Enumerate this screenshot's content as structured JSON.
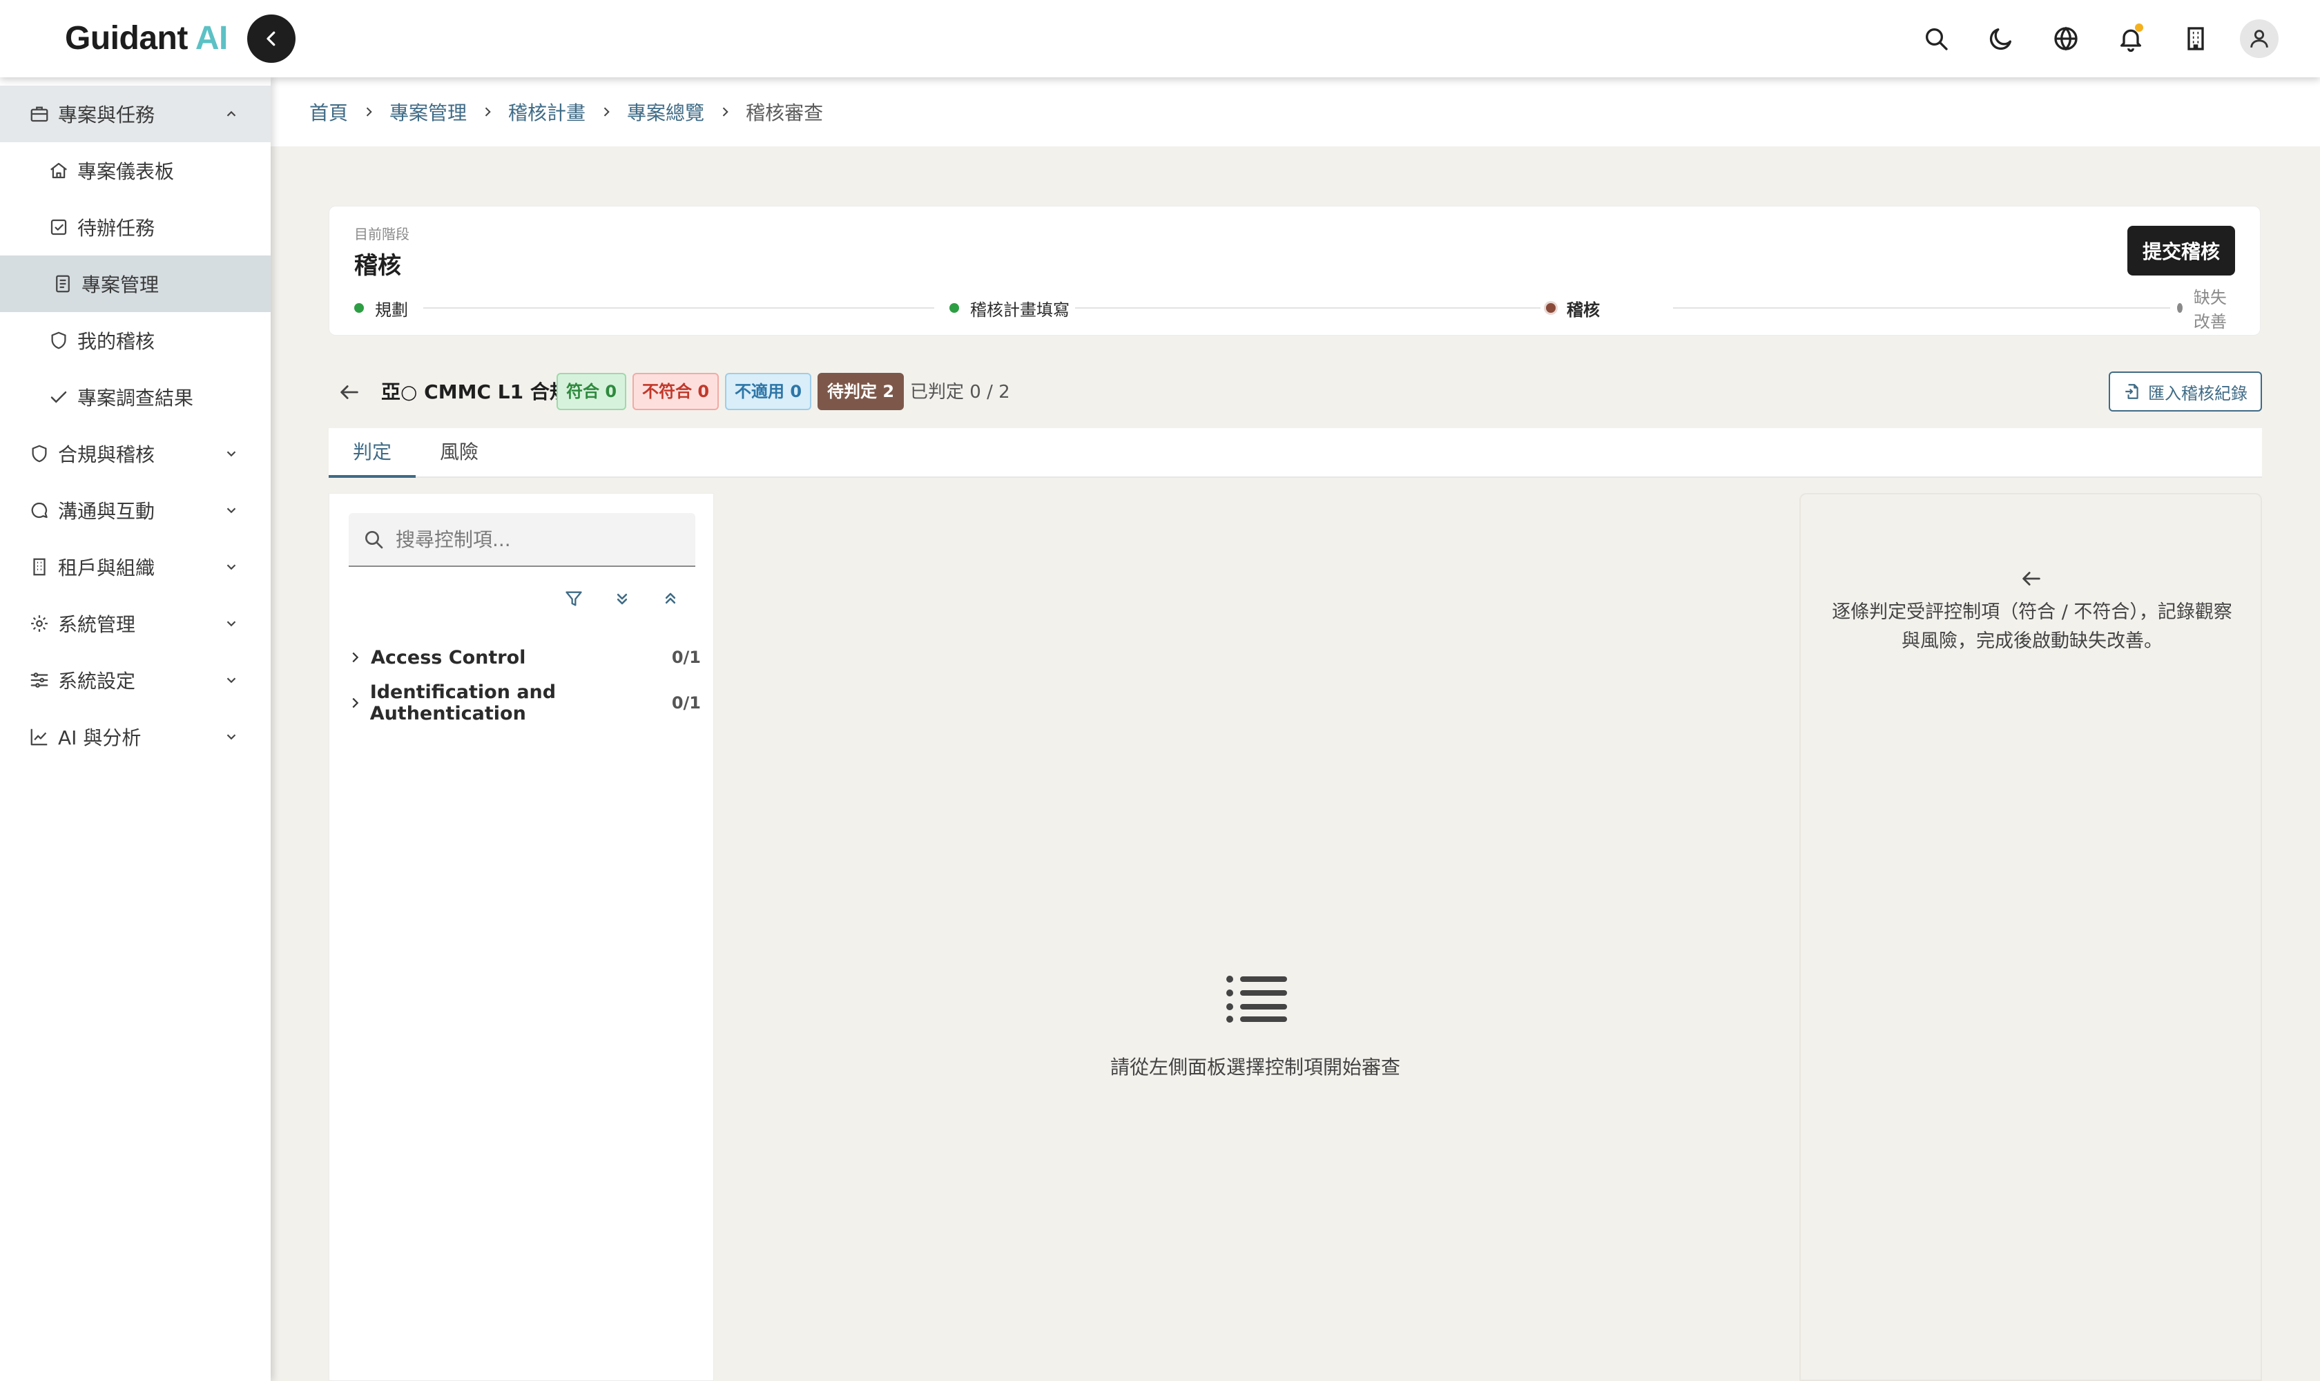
{
  "app": {
    "name": "Guidant",
    "name_accent": "AI"
  },
  "header": {
    "icons": [
      "search-icon",
      "moon-icon",
      "globe-icon",
      "bell-icon",
      "building-icon",
      "user-icon"
    ],
    "notification_dot_color": "#f4b11d"
  },
  "sidebar": {
    "items": [
      {
        "label": "專案與任務",
        "icon": "briefcase-icon",
        "type": "group",
        "expanded": true
      },
      {
        "label": "專案儀表板",
        "icon": "home-icon",
        "type": "child"
      },
      {
        "label": "待辦任務",
        "icon": "checkbox-icon",
        "type": "child"
      },
      {
        "label": "專案管理",
        "icon": "document-icon",
        "type": "child",
        "active": true
      },
      {
        "label": "我的稽核",
        "icon": "shield-icon",
        "type": "child"
      },
      {
        "label": "專案調查結果",
        "icon": "check-icon",
        "type": "child"
      },
      {
        "label": "合規與稽核",
        "icon": "shield-icon",
        "type": "group"
      },
      {
        "label": "溝通與互動",
        "icon": "chat-icon",
        "type": "group"
      },
      {
        "label": "租戶與組織",
        "icon": "building-icon",
        "type": "group"
      },
      {
        "label": "系統管理",
        "icon": "gear-icon",
        "type": "group"
      },
      {
        "label": "系統設定",
        "icon": "sliders-icon",
        "type": "group"
      },
      {
        "label": "AI 與分析",
        "icon": "chart-icon",
        "type": "group"
      }
    ]
  },
  "breadcrumb": [
    "首頁",
    "專案管理",
    "稽核計畫",
    "專案總覽",
    "稽核審查"
  ],
  "stage": {
    "label": "目前階段",
    "title": "稽核",
    "submit_label": "提交稽核",
    "steps": [
      {
        "label": "規劃",
        "status": "done"
      },
      {
        "label": "稽核計畫填寫",
        "status": "done"
      },
      {
        "label": "稽核",
        "status": "active"
      },
      {
        "label": "缺失改善",
        "status": "pending"
      }
    ],
    "colors": {
      "done": "#2e9e44",
      "active": "#8a4a3a",
      "pending": "#8a8a8a"
    }
  },
  "audit": {
    "name": "亞○ CMMC L1 合規",
    "badges": {
      "pass": "符合 0",
      "fail": "不符合 0",
      "na": "不適用 0",
      "pending": "待判定 2"
    },
    "judged": "已判定 0 / 2",
    "import_label": "匯入稽核紀錄"
  },
  "tabs": [
    {
      "label": "判定",
      "active": true
    },
    {
      "label": "風險",
      "active": false
    }
  ],
  "controls": {
    "search_placeholder": "搜尋控制項...",
    "tools": [
      "filter-icon",
      "expand-all-icon",
      "collapse-all-icon"
    ],
    "groups": [
      {
        "label": "Access Control",
        "count": "0/1"
      },
      {
        "label": "Identification and Authentication",
        "count": "0/1"
      }
    ]
  },
  "empty_state": {
    "text": "請從左側面板選擇控制項開始審查"
  },
  "hint": {
    "text": "逐條判定受評控制項（符合 / 不符合），記錄觀察與風險，完成後啟動缺失改善。"
  },
  "colors": {
    "accent": "#5cc1c5",
    "link": "#3f6b86",
    "dark": "#1e1e1e"
  }
}
